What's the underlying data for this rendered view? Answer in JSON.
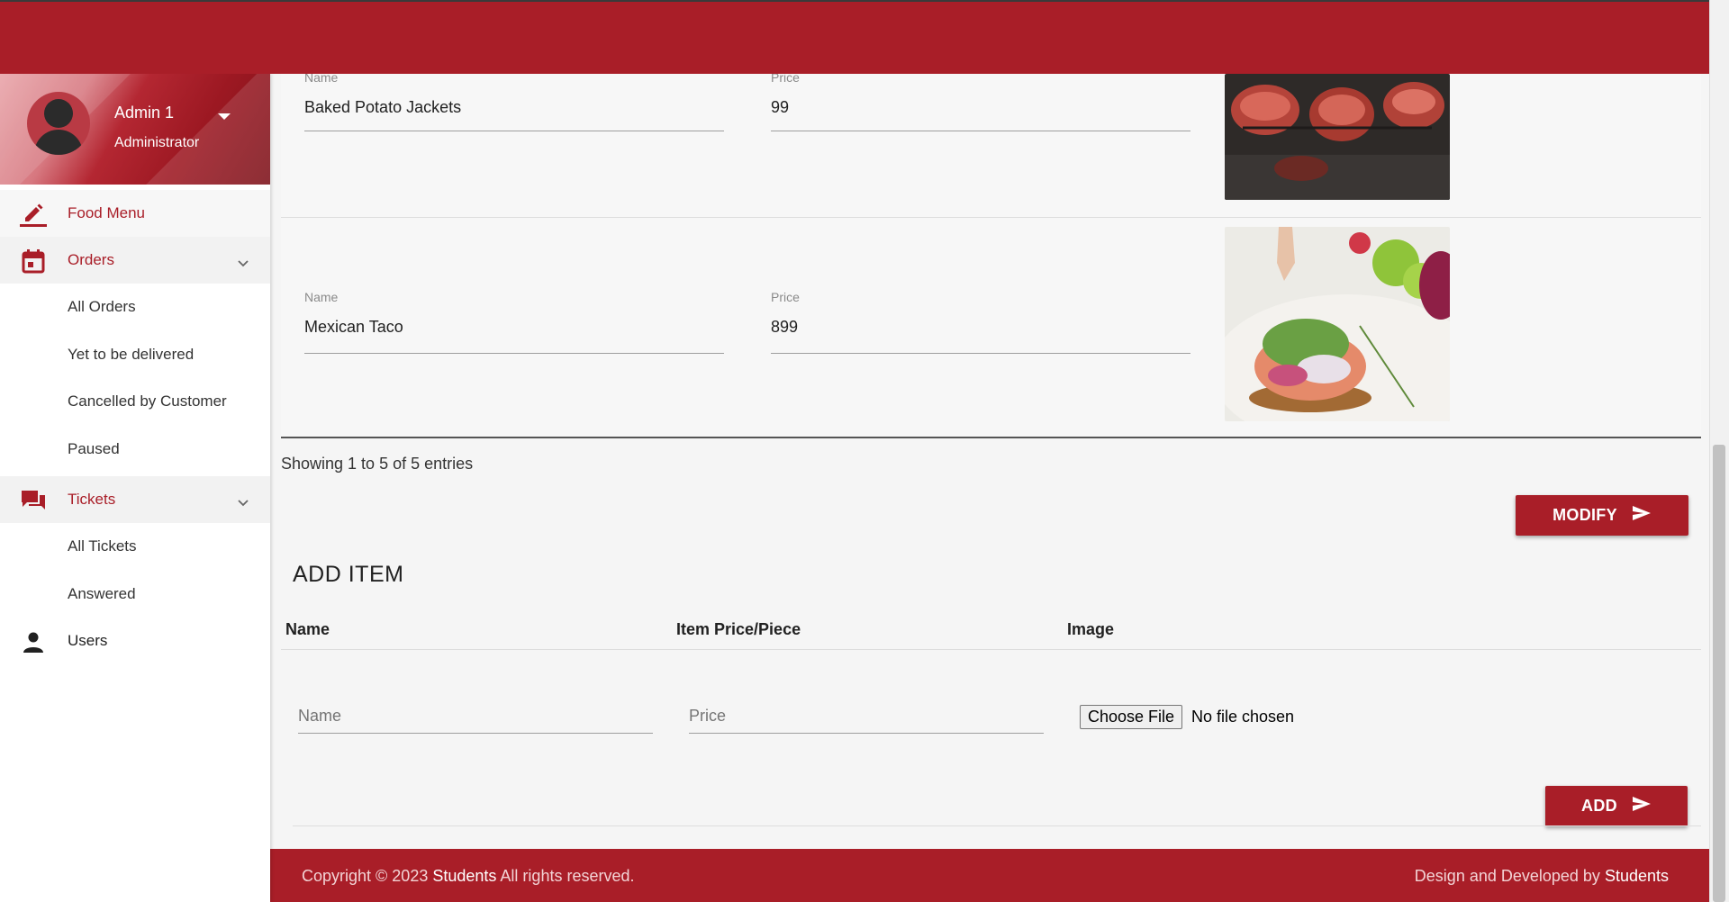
{
  "colors": {
    "primary": "#a91e28",
    "background": "#f5f5f5",
    "sidebar": "#ffffff"
  },
  "profile": {
    "name": "Admin 1",
    "role": "Administrator"
  },
  "sidebar": {
    "items": [
      {
        "label": "Food Menu",
        "icon": "pencil-icon"
      },
      {
        "label": "Orders",
        "icon": "calendar-icon",
        "sub": [
          "All Orders",
          "Yet to be delivered",
          "Cancelled by Customer",
          "Paused"
        ]
      },
      {
        "label": "Tickets",
        "icon": "chat-icon",
        "sub": [
          "All Tickets",
          "Answered"
        ]
      },
      {
        "label": "Users",
        "icon": "person-icon"
      }
    ]
  },
  "menu_items": [
    {
      "name_label": "Name",
      "name": "Baked Potato Jackets",
      "price_label": "Price",
      "price": "99",
      "image": "grilled-salmon-photo"
    },
    {
      "name_label": "Name",
      "name": "Mexican Taco",
      "price_label": "Price",
      "price": "899",
      "image": "taco-photo"
    }
  ],
  "entries_text": "Showing 1 to 5 of 5 entries",
  "modify_label": "MODIFY",
  "add_item": {
    "title": "ADD ITEM",
    "headers": [
      "Name",
      "Item Price/Piece",
      "Image"
    ],
    "name_placeholder": "Name",
    "price_placeholder": "Price",
    "file_button": "Choose File",
    "file_status": "No file chosen",
    "add_label": "ADD"
  },
  "footer": {
    "left_prefix": "Copyright © 2023 ",
    "left_brand": "Students",
    "left_suffix": " All rights reserved.",
    "right_prefix": "Design and Developed by ",
    "right_brand": "Students"
  }
}
